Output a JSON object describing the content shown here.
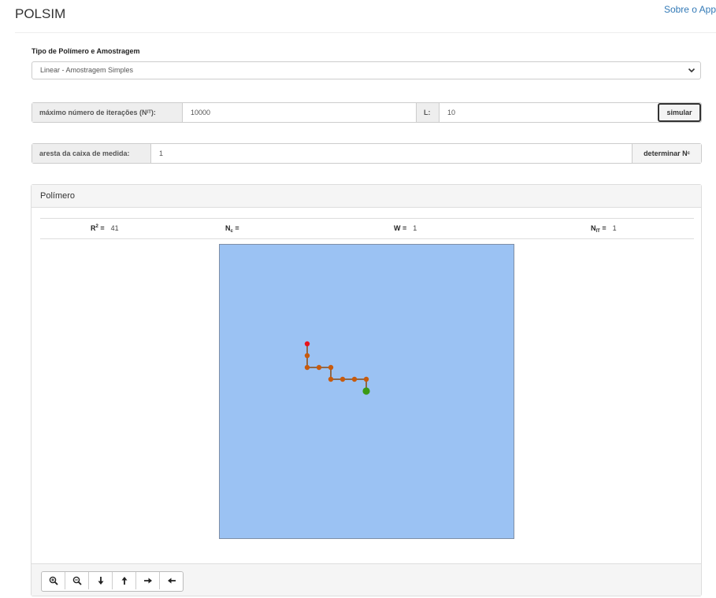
{
  "app": {
    "title": "POLSIM",
    "nav_link": "Sobre o App"
  },
  "polymer_type": {
    "label": "Tipo de Polímero e Amostragem",
    "selected": "Linear - Amostragem Simples"
  },
  "simulation": {
    "max_iter_label": "máximo número de iterações (N",
    "max_iter_sub": "IT",
    "max_iter_suffix": "):",
    "max_iter_value": "10000",
    "l_label": "L:",
    "l_value": "10",
    "simulate_button": "simular"
  },
  "measure": {
    "box_edge_label": "aresta da caixa de medida:",
    "box_edge_value": "1",
    "determine_button": "determinar N",
    "determine_sub": "c"
  },
  "panel": {
    "title": "Polímero",
    "stats": {
      "r2_label": "R",
      "r2_sup": "2",
      "r2_eq": " =",
      "r2_value": "41",
      "nc_label": "N",
      "nc_sub": "c",
      "nc_eq": " =",
      "nc_value": "",
      "w_label": "W =",
      "w_value": "1",
      "nit_label": "N",
      "nit_sub": "IT",
      "nit_eq": " =",
      "nit_value": "1"
    }
  },
  "lattice": {
    "background": "#9bc2f3",
    "border": "#7f8fa6",
    "bond_color": "#8a4a12",
    "monomer_color": "#c85a0c",
    "start_color": "#e8131a",
    "end_color": "#3a9a14",
    "chain": [
      [
        0,
        0
      ],
      [
        0,
        -1
      ],
      [
        0,
        -2
      ],
      [
        1,
        -2
      ],
      [
        2,
        -2
      ],
      [
        2,
        -3
      ],
      [
        3,
        -3
      ],
      [
        4,
        -3
      ],
      [
        5,
        -3
      ],
      [
        5,
        -4
      ]
    ]
  },
  "toolbar": {
    "buttons": [
      "zoom-in-icon",
      "zoom-out-icon",
      "arrow-down-icon",
      "arrow-up-icon",
      "arrow-right-icon",
      "arrow-left-icon"
    ]
  }
}
